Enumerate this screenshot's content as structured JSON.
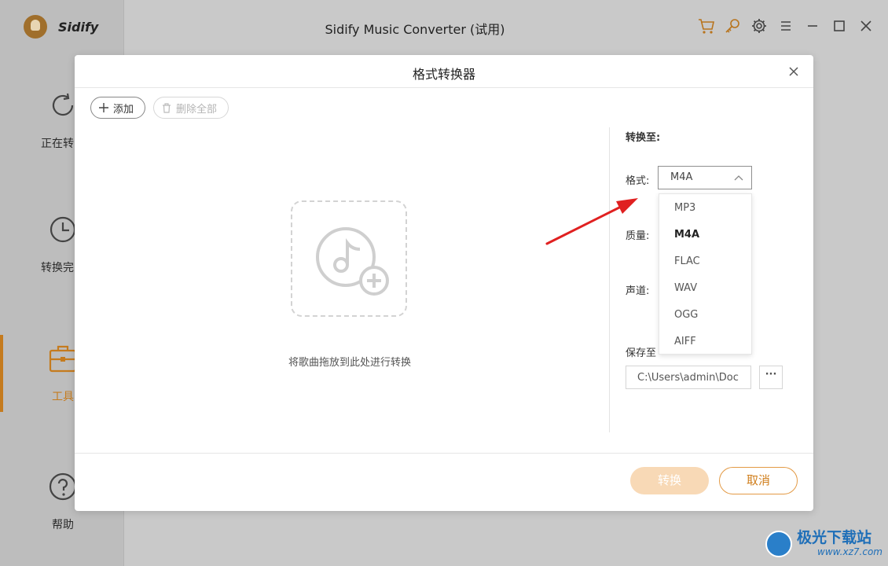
{
  "app": {
    "name": "Sidify",
    "window_title": "Sidify Music Converter (试用)"
  },
  "sidebar": {
    "items": [
      {
        "label": "正在转",
        "icon": "refresh-icon"
      },
      {
        "label": "转换完",
        "icon": "clock-icon"
      },
      {
        "label": "工具",
        "icon": "toolbox-icon"
      },
      {
        "label": "帮助",
        "icon": "help-icon"
      }
    ]
  },
  "titlebar_icons": [
    "cart-icon",
    "key-icon",
    "gear-icon",
    "menu-icon",
    "maximize-icon",
    "close-icon"
  ],
  "modal": {
    "title": "格式转换器",
    "toolbar": {
      "add_label": "添加",
      "delete_all_label": "删除全部"
    },
    "drop_hint": "将歌曲拖放到此处进行转换",
    "settings": {
      "heading": "转换至:",
      "format_label": "格式:",
      "format_value": "M4A",
      "format_options": [
        "MP3",
        "M4A",
        "FLAC",
        "WAV",
        "OGG",
        "AIFF"
      ],
      "selected_option": "M4A",
      "quality_label": "质量:",
      "channel_label": "声道:",
      "save_label": "保存至",
      "save_path": "C:\\Users\\admin\\Doc",
      "browse_label": "···"
    },
    "footer": {
      "convert_label": "转换",
      "cancel_label": "取消"
    }
  },
  "colors": {
    "accent": "#d07e1b",
    "convert_disabled": "#f8d9b6",
    "annotation_arrow": "#e02020"
  },
  "watermark": {
    "main": "极光下载站",
    "sub": "www.xz7.com"
  }
}
